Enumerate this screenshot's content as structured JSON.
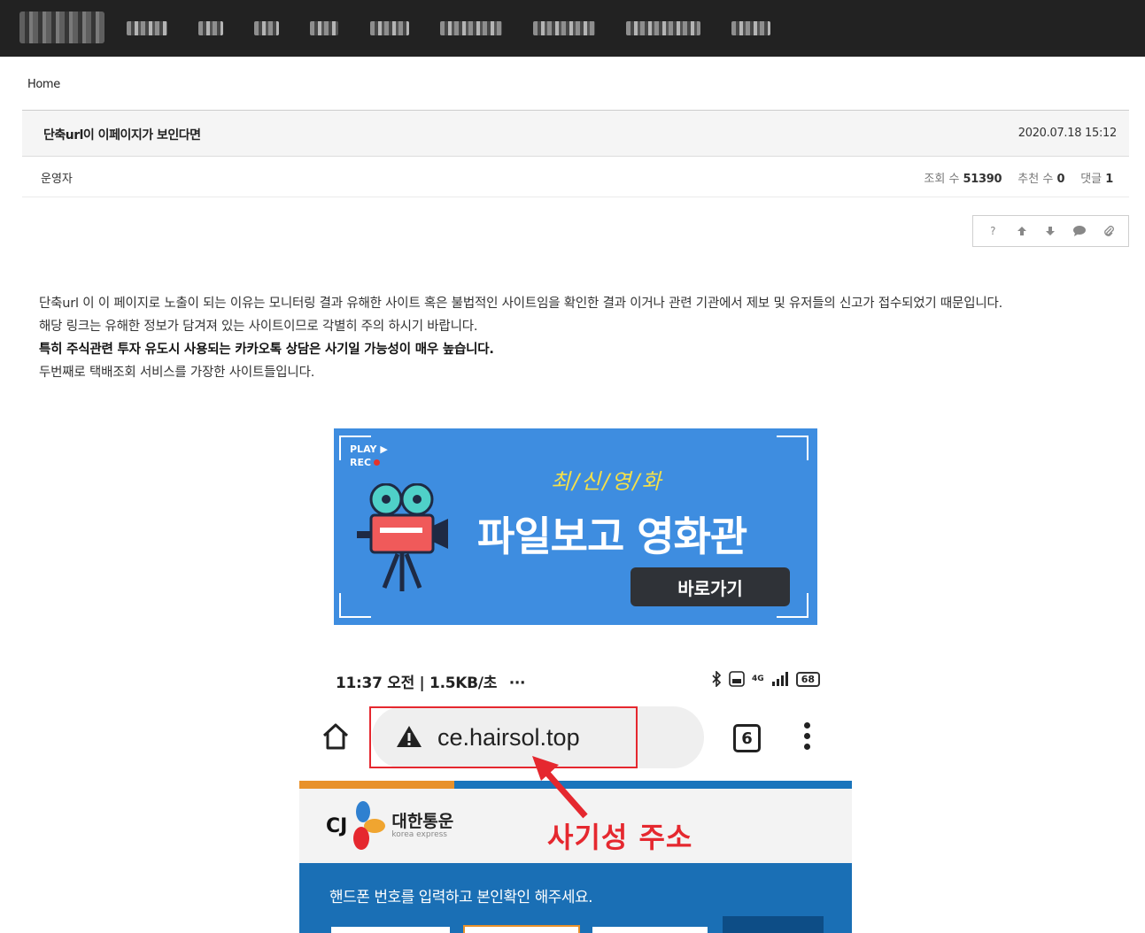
{
  "breadcrumb": {
    "home": "Home"
  },
  "post": {
    "title": "단축url이 이페이지가 보인다면",
    "date": "2020.07.18 15:12",
    "author": "운영자",
    "views_label": "조회 수",
    "views": "51390",
    "likes_label": "추천 수",
    "likes": "0",
    "comments_label": "댓글",
    "comments": "1"
  },
  "toolbar": {
    "help": "?"
  },
  "content": {
    "p1": "단축url 이 이 페이지로 노출이 되는 이유는 모니터링 결과 유해한 사이트 혹은 불법적인 사이트임을 확인한 결과 이거나 관련 기관에서 제보 및 유저들의 신고가 접수되었기 때문입니다.",
    "p2": "해당 링크는 유해한 정보가 담겨져 있는 사이트이므로 각별히 주의 하시기 바랍니다.",
    "p3": "특히 주식관련 투자 유도시 사용되는 카카오톡 상담은 사기일 가능성이 매우 높습니다.",
    "p4": "두번째로 택배조회 서비스를 가장한 사이트들입니다."
  },
  "banner": {
    "play": "PLAY",
    "rec": "REC",
    "subtitle": "최/신/영/화",
    "title": "파일보고 영화관",
    "button": "바로가기",
    "bg_color": "#3e8de0"
  },
  "phone": {
    "status_time": "11:37 오전 | 1.5KB/초",
    "status_more": "···",
    "network": "4G",
    "battery": "68",
    "url": "ce.hairsol.top",
    "tab_count": "6",
    "cj_logo": "CJ",
    "brand_ko": "대한통운",
    "brand_en": "korea express",
    "scam_label": "사기성 주소",
    "instruction": "핸드폰 번호를 입력하고 본인확인 해주세요.",
    "accent_red": "#e5282f",
    "accent_blue": "#1a6fb5",
    "accent_orange": "#e8912b"
  }
}
